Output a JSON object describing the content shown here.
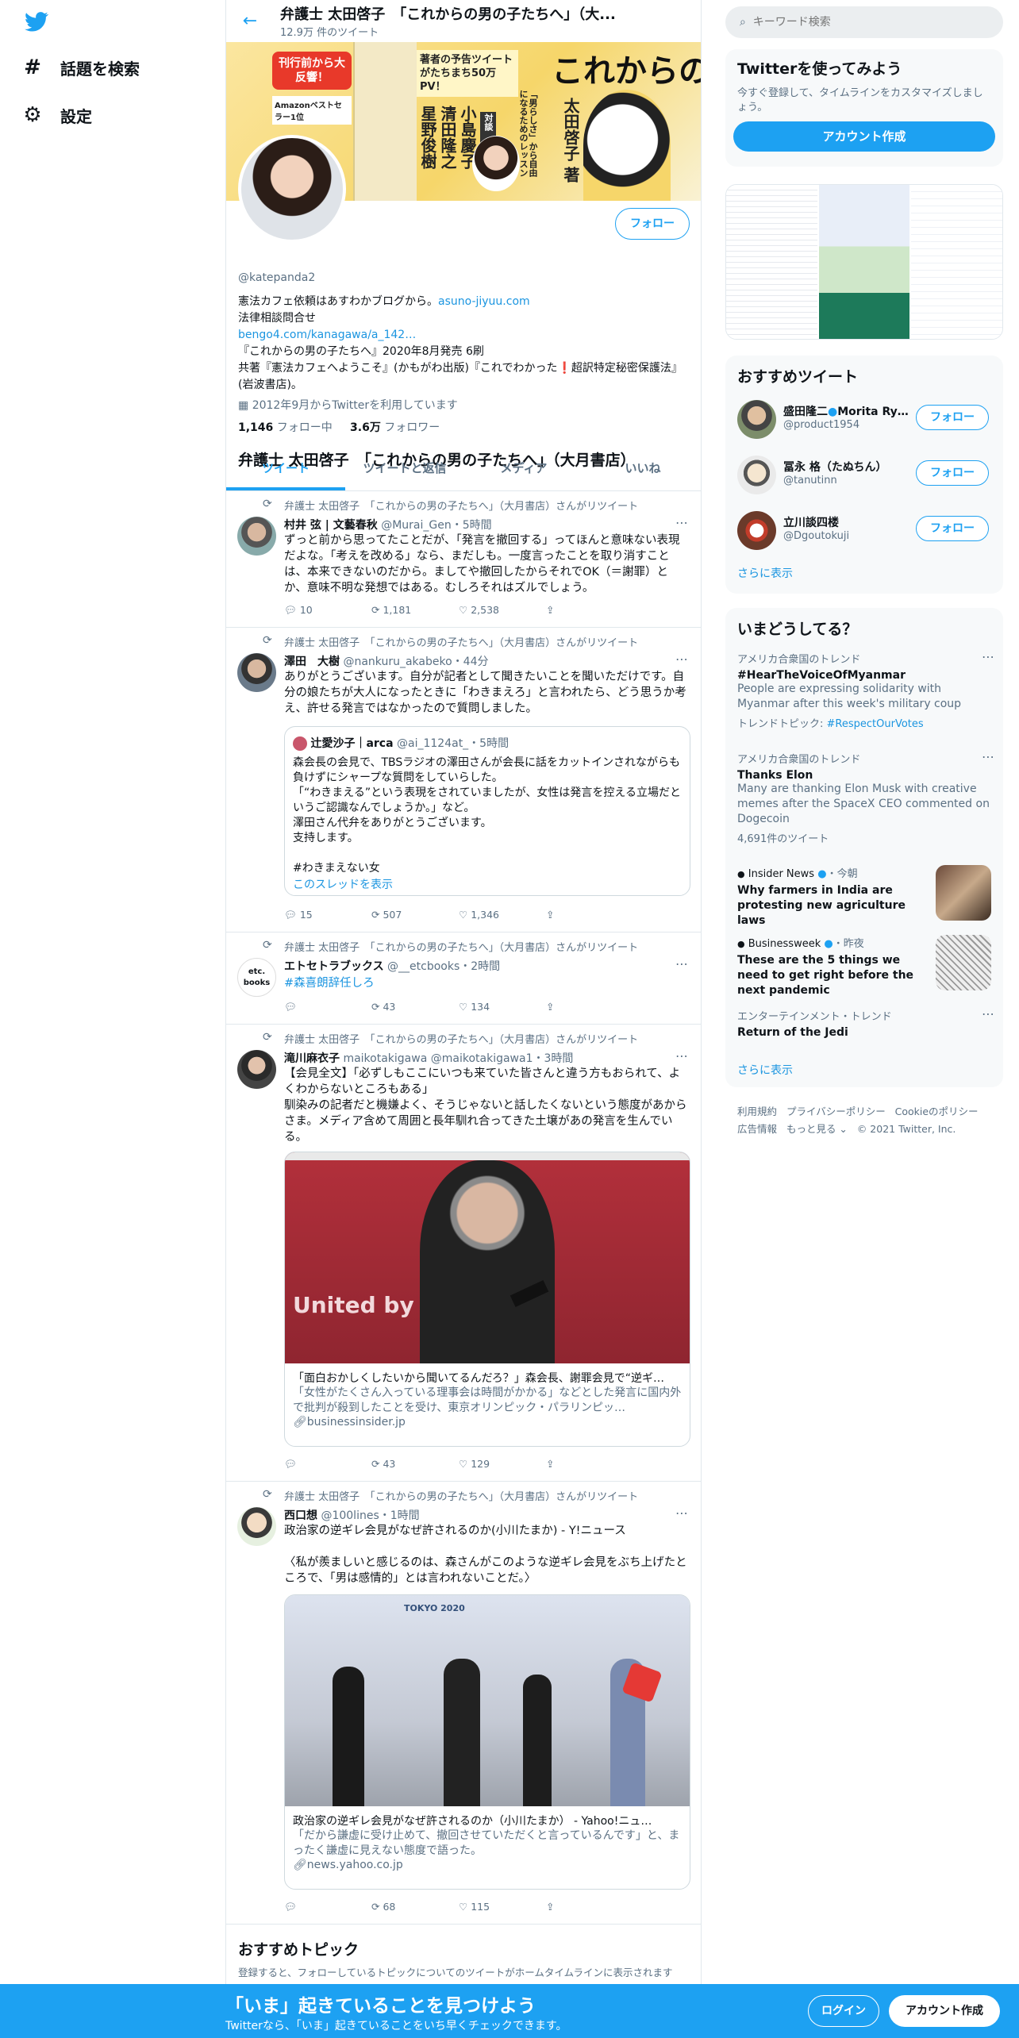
{
  "nav": {
    "explore": "話題を検索",
    "settings": "設定"
  },
  "header": {
    "title": "弁護士 太田啓子　「これからの男の子たちへ」（大...",
    "tweet_count": "12.9万 件のツイート"
  },
  "banner": {
    "badge": "刊行前から大反響！",
    "amazon": "Amazonベストセラー1位",
    "preview": "著者の予告ツイートがたちまち50万PV！",
    "title": "これからの男の子たちへ",
    "vertical": "「男らしさ」から自由になるためのレッスン",
    "names": [
      "太田啓子 著",
      "小島慶子",
      "清田隆之",
      "星野俊樹"
    ],
    "taidan": "対談"
  },
  "profile": {
    "follow": "フォロー",
    "name": "弁護士 太田啓子　「これからの男の子たちへ」（大月書店）",
    "handle": "@katepanda2",
    "bio1": "憲法カフェ依頼はあすわかブログから。",
    "bio1_link": "asuno-jiyuu.com",
    "bio2": "法律相談問合せ",
    "bio3_link": "bengo4.com/kanagawa/a_142…",
    "bio4": "『これからの男の子たちへ』2020年8月発売 6刷",
    "bio5": "共著『憲法カフェへようこそ』(かもがわ出版)『これでわかった❗超訳特定秘密保護法』(岩波書店)。",
    "joined": "2012年9月からTwitterを利用しています",
    "following_count": "1,146",
    "following_label": "フォロー中",
    "followers_count": "3.6万",
    "followers_label": "フォロワー"
  },
  "tabs": [
    "ツイート",
    "ツイートと返信",
    "メディア",
    "いいね"
  ],
  "rt_label": "弁護士 太田啓子　「これからの男の子たちへ」（大月書店）さんがリツイート",
  "tweets": [
    {
      "name": "村井 弦 | 文藝春秋",
      "handle": "@Murai_Gen",
      "time": "・5時間",
      "text": "ずっと前から思ってたことだが、「発言を撤回する」ってほんと意味ない表現だよな。「考えを改める」なら、まだしも。一度言ったことを取り消すことは、本来できないのだから。ましてや撤回したからそれでOK（＝謝罪）とか、意味不明な発想ではある。むしろそれはズルでしょう。",
      "reply": "10",
      "rt": "1,181",
      "like": "2,538"
    },
    {
      "name": "澤田　大樹",
      "handle": "@nankuru_akabeko",
      "time": "・44分",
      "text": "ありがとうございます。自分が記者として聞きたいことを聞いただけです。自分の娘たちが大人になったときに「わきまえろ」と言われたら、どう思うか考え、許せる発言ではなかったので質問しました。",
      "quote_name": "辻愛沙子｜arca",
      "quote_handle": "@ai_1124at_",
      "quote_time": "・5時間",
      "quote_text": "森会長の会見で、TBSラジオの澤田さんが会長に話をカットインされながらも負けずにシャープな質問をしていらした。\n「“わきまえる”という表現をされていましたが、女性は発言を控える立場だというご認識なんでしょうか。」など。\n澤田さん代弁をありがとうございます。\n支持します。\n\n#わきまえない女",
      "quote_thread": "このスレッドを表示",
      "reply": "15",
      "rt": "507",
      "like": "1,346"
    },
    {
      "name": "エトセトラブックス",
      "handle": "@__etcbooks",
      "time": "・2時間",
      "text": "#森喜朗辞任しろ",
      "reply": "",
      "rt": "43",
      "like": "134",
      "avatar_text": "etc. books"
    },
    {
      "name": "滝川麻衣子",
      "handle": "maikotakigawa @maikotakigawa1",
      "time": "・3時間",
      "text": "【会見全文】「必ずしもここにいつも来ていた皆さんと違う方もおられて、よくわからないところもある」\n馴染みの記者だと機嫌よく、そうじゃないと話したくないという態度があからさま。メディア含めて周囲と長年馴れ合ってきた土壌があの発言を生んでいる。",
      "card_title": "「面白おかしくしたいから聞いてるんだろ？」森会長、謝罪会見で“逆ギ…",
      "card_desc": "「女性がたくさん入っている理事会は時間がかかる」などとした発言に国内外で批判が殺到したことを受け、東京オリンピック・パラリンピッ…",
      "card_domain": "businessinsider.jp",
      "card_logo": "United by E",
      "reply": "",
      "rt": "43",
      "like": "129"
    },
    {
      "name": "西口想",
      "handle": "@100lines",
      "time": "・1時間",
      "text": "政治家の逆ギレ会見がなぜ許されるのか(小川たまか) - Y!ニュース\n\n〈私が羨ましいと感じるのは、森さんがこのような逆ギレ会見をぶち上げたところで、「男は感情的」とは言われないことだ。〉",
      "card_title": "政治家の逆ギレ会見がなぜ許されるのか（小川たまか） - Yahoo!ニュ…",
      "card_desc": "「だから謙虚に受け止めて、撤回させていただくと言っているんです」と、まったく謙虚に見えない態度で語った。",
      "card_domain": "news.yahoo.co.jp",
      "card_logo": "TOKYO 2020",
      "reply": "",
      "rt": "68",
      "like": "115"
    }
  ],
  "topics": {
    "title": "おすすめトピック",
    "desc": "登録すると、フォローしているトピックについてのツイートがホームタイムラインに表示されます"
  },
  "search": {
    "placeholder": "キーワード検索"
  },
  "signup": {
    "title": "Twitterを使ってみよう",
    "desc": "今すぐ登録して、タイムラインをカスタマイズしましょう。",
    "button": "アカウント作成"
  },
  "who": {
    "title": "おすすめツイート",
    "users": [
      {
        "name": "盛田隆二",
        "name_suffix": "Morita Ry…",
        "handle": "@product1954"
      },
      {
        "name": "冨永 格（たぬちん）",
        "handle": "@tanutinn"
      },
      {
        "name": "立川談四楼",
        "handle": "@Dgoutokuji"
      }
    ],
    "follow": "フォロー",
    "more": "さらに表示"
  },
  "trends": {
    "title": "いまどうしてる？",
    "items": [
      {
        "meta": "アメリカ合衆国のトレンド",
        "name": "#HearTheVoiceOfMyanmar",
        "desc": "People are expressing solidarity with Myanmar after this week's military coup",
        "extra": "トレンドトピック: ",
        "extra_link": "#RespectOurVotes"
      },
      {
        "meta": "アメリカ合衆国のトレンド",
        "name": "Thanks Elon",
        "desc": "Many are thanking Elon Musk with creative memes after the SpaceX CEO commented on Dogecoin",
        "extra": "4,691件のツイート"
      },
      {
        "meta": "Insider News",
        "meta2": "・今朝",
        "name": "Why farmers in India are protesting new agriculture laws"
      },
      {
        "meta": "Businessweek",
        "meta2": "・昨夜",
        "name": "These are the 5 things we need to get right before the next pandemic"
      },
      {
        "meta": "エンターテインメント・トレンド",
        "name": "Return of the Jedi"
      }
    ],
    "more": "さらに表示"
  },
  "legal": {
    "line1": [
      "利用規約",
      "プライバシーポリシー",
      "Cookieのポリシー"
    ],
    "line2": [
      "広告情報",
      "もっと見る ⌄",
      "© 2021 Twitter, Inc."
    ]
  },
  "footer": {
    "title": "「いま」起きていることを見つけよう",
    "sub": "Twitterなら、「いま」起きていることをいち早くチェックできます。",
    "login": "ログイン",
    "signup": "アカウント作成"
  },
  "colors": {
    "accent": "#1da1f2",
    "text": "#0f1419",
    "muted": "#5b7083",
    "banner": "#f6d66a"
  }
}
